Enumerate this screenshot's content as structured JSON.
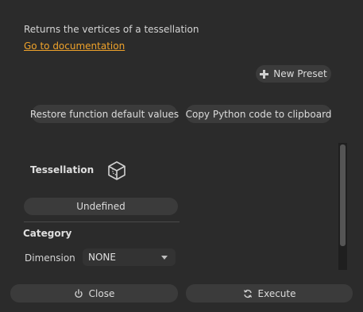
{
  "description": "Returns the vertices of a tessellation",
  "doc_link": "Go to documentation",
  "new_preset_label": "New Preset",
  "restore_label": "Restore function default values",
  "copy_label": "Copy Python code to clipboard",
  "tessellation": {
    "label": "Tessellation",
    "icon": "cube-icon",
    "value": "Undefined"
  },
  "category": {
    "label": "Category",
    "dimension_label": "Dimension",
    "dimension_value": "NONE"
  },
  "footer": {
    "close_label": "Close",
    "execute_label": "Execute"
  },
  "colors": {
    "background": "#2b2b2b",
    "button": "#3b3b3b",
    "link": "#f0a32b"
  }
}
